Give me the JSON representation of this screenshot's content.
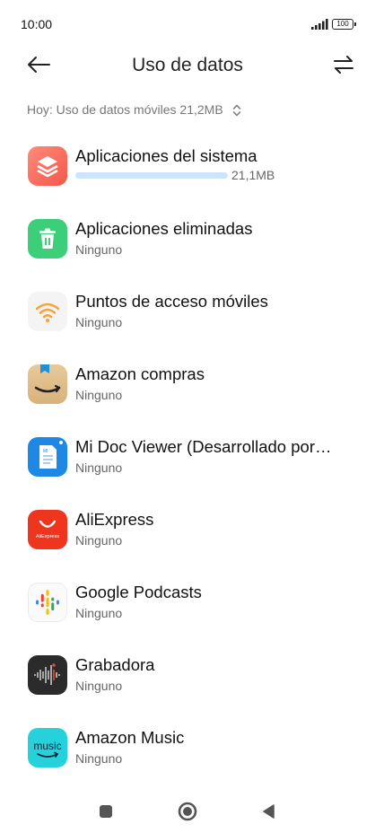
{
  "status_bar": {
    "time": "10:00",
    "battery": "100"
  },
  "header": {
    "title": "Uso de datos",
    "back_icon": "arrow-left-icon",
    "filter_icon": "swap-arrows-icon"
  },
  "summary": {
    "text": "Hoy: Uso de datos móviles 21,2MB"
  },
  "apps": [
    {
      "name": "Aplicaciones del sistema",
      "usage": "21,1MB",
      "usage_fraction": 1.0,
      "icon": "system-apps-icon"
    },
    {
      "name": "Aplicaciones eliminadas",
      "sub": "Ninguno",
      "icon": "trash-icon"
    },
    {
      "name": "Puntos de acceso móviles",
      "sub": "Ninguno",
      "icon": "wifi-hotspot-icon"
    },
    {
      "name": "Amazon compras",
      "sub": "Ninguno",
      "icon": "amazon-shopping-icon"
    },
    {
      "name": "Mi Doc Viewer (Desarrollado por…",
      "sub": "Ninguno",
      "icon": "doc-viewer-icon",
      "icon_text": "MI"
    },
    {
      "name": "AliExpress",
      "sub": "Ninguno",
      "icon": "aliexpress-icon",
      "icon_text": "AliExpress"
    },
    {
      "name": "Google Podcasts",
      "sub": "Ninguno",
      "icon": "google-podcasts-icon"
    },
    {
      "name": "Grabadora",
      "sub": "Ninguno",
      "icon": "recorder-icon"
    },
    {
      "name": "Amazon Music",
      "sub": "Ninguno",
      "icon": "amazon-music-icon",
      "icon_text": "music"
    }
  ],
  "nav": {
    "recents": "square-icon",
    "home": "circle-icon",
    "back": "triangle-back-icon"
  },
  "colors": {
    "usage_bar": "#cde4fb",
    "accent_blue": "#1e88e5"
  }
}
